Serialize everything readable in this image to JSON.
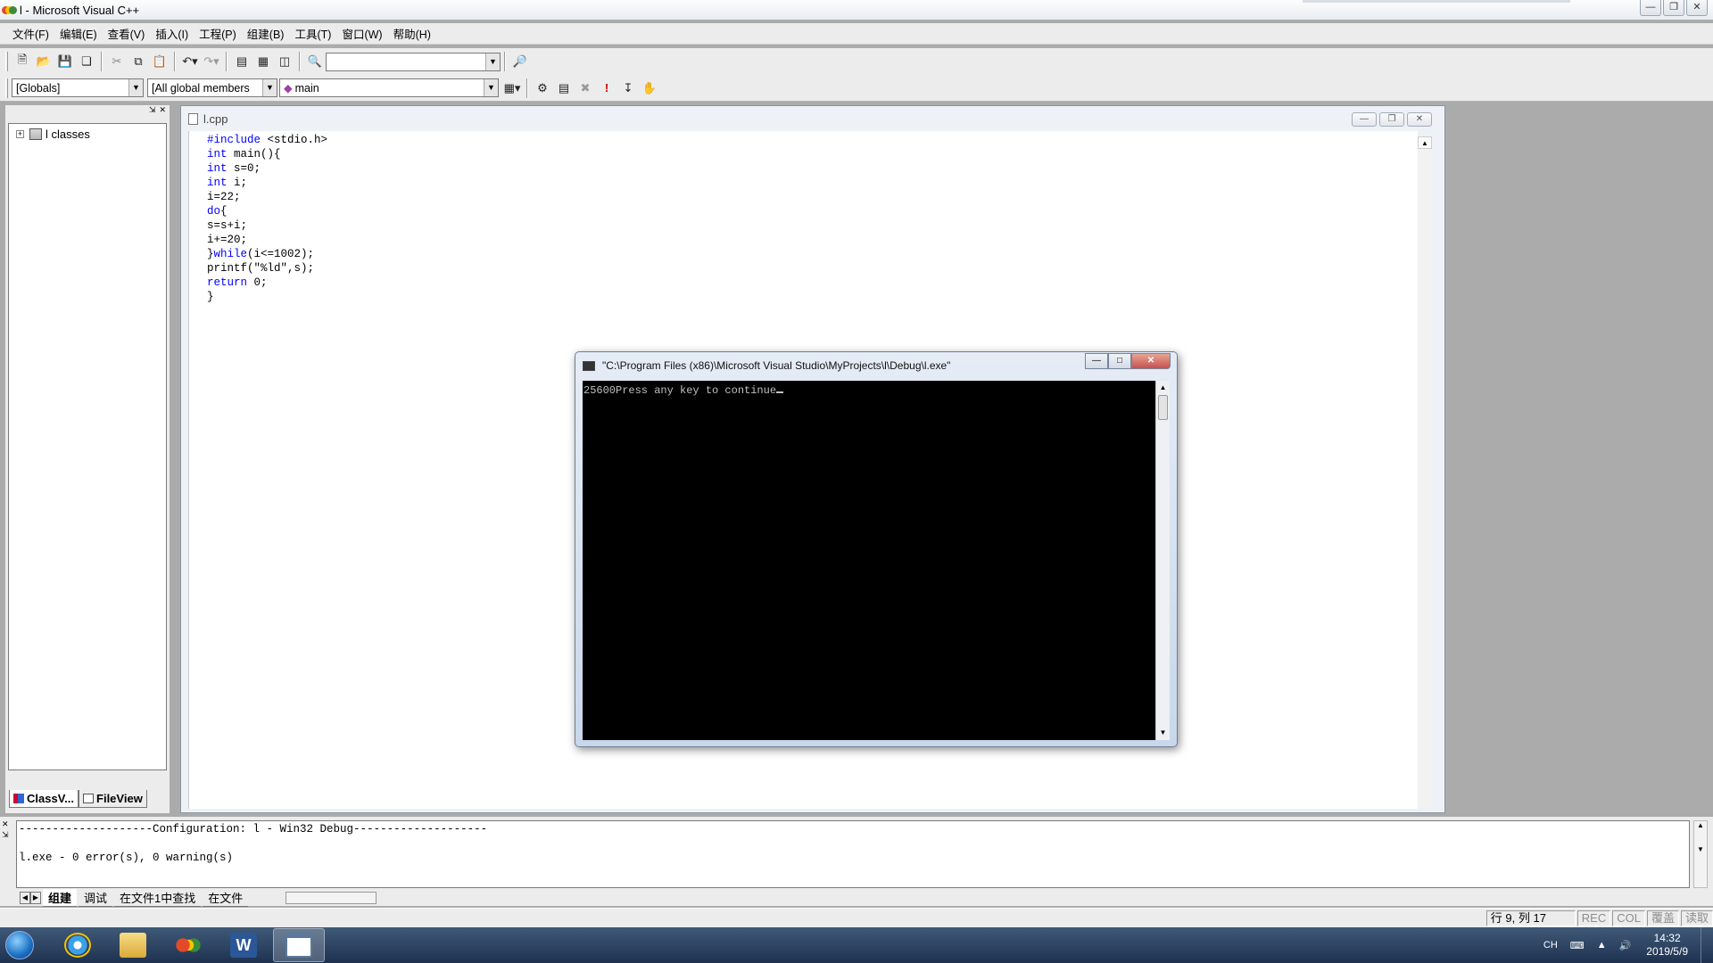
{
  "window": {
    "title": "l - Microsoft Visual C++"
  },
  "menu": [
    "文件(F)",
    "编辑(E)",
    "查看(V)",
    "插入(I)",
    "工程(P)",
    "组建(B)",
    "工具(T)",
    "窗口(W)",
    "帮助(H)"
  ],
  "toolbar": {
    "find_combo_value": "",
    "globals_combo": "[Globals]",
    "members_combo": "[All global members",
    "function_combo": "main"
  },
  "workspace": {
    "tree_root": "l classes",
    "tabs": [
      "ClassV...",
      "FileView"
    ]
  },
  "editor": {
    "tab_title": "l.cpp",
    "code_lines": [
      [
        {
          "t": "#include",
          "k": true
        },
        {
          "t": " <stdio.h>",
          "k": false
        }
      ],
      [
        {
          "t": "int",
          "k": true
        },
        {
          "t": " main(){",
          "k": false
        }
      ],
      [
        {
          "t": "int",
          "k": true
        },
        {
          "t": " s=0;",
          "k": false
        }
      ],
      [
        {
          "t": "int",
          "k": true
        },
        {
          "t": " i;",
          "k": false
        }
      ],
      [
        {
          "t": "i=22;",
          "k": false
        }
      ],
      [
        {
          "t": "do",
          "k": true
        },
        {
          "t": "{",
          "k": false
        }
      ],
      [
        {
          "t": "s=s+i;",
          "k": false
        }
      ],
      [
        {
          "t": "i+=20;",
          "k": false
        }
      ],
      [
        {
          "t": "}",
          "k": false
        },
        {
          "t": "while",
          "k": true
        },
        {
          "t": "(i<=1002);",
          "k": false
        }
      ],
      [
        {
          "t": "printf(\"%ld\",s);",
          "k": false
        }
      ],
      [
        {
          "t": "return",
          "k": true
        },
        {
          "t": " 0;",
          "k": false
        }
      ],
      [
        {
          "t": "}",
          "k": false
        }
      ]
    ]
  },
  "console": {
    "title": "\"C:\\Program Files (x86)\\Microsoft Visual Studio\\MyProjects\\l\\Debug\\l.exe\"",
    "output": "25600Press any key to continue"
  },
  "output_pane": {
    "lines": [
      "--------------------Configuration: l - Win32 Debug--------------------",
      "",
      "l.exe - 0 error(s), 0 warning(s)"
    ],
    "tabs": [
      "组建",
      "调试",
      "在文件1中查找",
      "在文件"
    ]
  },
  "statusbar": {
    "position": "行 9, 列 17",
    "indicators": [
      "REC",
      "COL",
      "覆盖",
      "读取"
    ]
  },
  "taskbar": {
    "tray_lang": "CH",
    "time": "14:32",
    "date": "2019/5/9"
  },
  "colors": {
    "keyword": "#0000ff",
    "console_bg": "#000000",
    "taskbar": "#1e3250"
  }
}
